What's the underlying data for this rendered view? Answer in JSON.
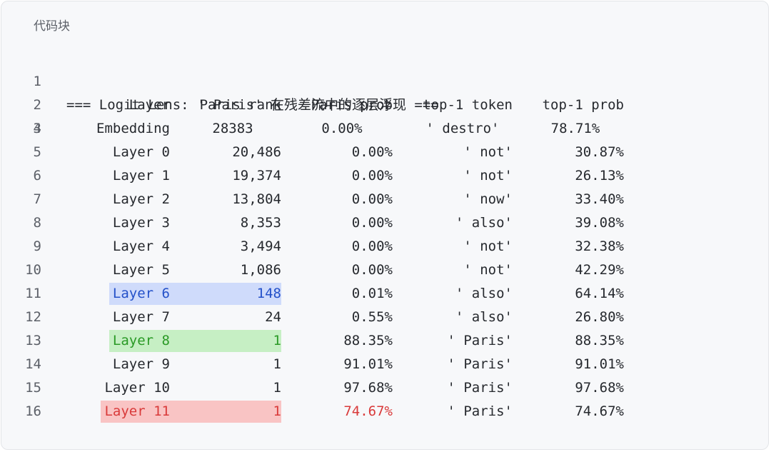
{
  "block_label": "代码块",
  "title_line": "=== Logit Lens: ' Paris' 在残差流中的逐层浮现 ===",
  "line_numbers": [
    "1",
    "2",
    "3",
    "4",
    "5",
    "6",
    "7",
    "8",
    "9",
    "10",
    "11",
    "12",
    "13",
    "14",
    "15",
    "16"
  ],
  "header": {
    "layer": "Layer",
    "rank": "Paris rank",
    "prob": "Paris prob",
    "token": "top-1 token",
    "tprob": "top-1 prob"
  },
  "rows": [
    {
      "layer": "Embedding",
      "rank": "28383",
      "prob": "0.00%",
      "token": "' destro'",
      "tprob": "78.71%"
    },
    {
      "layer": "Layer 0",
      "rank": "20,486",
      "prob": "0.00%",
      "token": "' not'",
      "tprob": "30.87%"
    },
    {
      "layer": "Layer 1",
      "rank": "19,374",
      "prob": "0.00%",
      "token": "' not'",
      "tprob": "26.13%"
    },
    {
      "layer": "Layer 2",
      "rank": "13,804",
      "prob": "0.00%",
      "token": "' now'",
      "tprob": "33.40%"
    },
    {
      "layer": "Layer 3",
      "rank": "8,353",
      "prob": "0.00%",
      "token": "' also'",
      "tprob": "39.08%"
    },
    {
      "layer": "Layer 4",
      "rank": "3,494",
      "prob": "0.00%",
      "token": "' not'",
      "tprob": "32.38%"
    },
    {
      "layer": "Layer 5",
      "rank": "1,086",
      "prob": "0.00%",
      "token": "' not'",
      "tprob": "42.29%"
    },
    {
      "layer": "Layer 6",
      "rank": "148",
      "prob": "0.01%",
      "token": "' also'",
      "tprob": "64.14%"
    },
    {
      "layer": "Layer 7",
      "rank": "24",
      "prob": "0.55%",
      "token": "' also'",
      "tprob": "26.80%"
    },
    {
      "layer": "Layer 8",
      "rank": "1",
      "prob": "88.35%",
      "token": "' Paris'",
      "tprob": "88.35%"
    },
    {
      "layer": "Layer 9",
      "rank": "1",
      "prob": "91.01%",
      "token": "' Paris'",
      "tprob": "91.01%"
    },
    {
      "layer": "Layer 10",
      "rank": "1",
      "prob": "97.68%",
      "token": "' Paris'",
      "tprob": "97.68%"
    },
    {
      "layer": "Layer 11",
      "rank": "1",
      "prob": "74.67%",
      "token": "' Paris'",
      "tprob": "74.67%"
    }
  ],
  "colors": {
    "blue_bg": "#cfdbfb",
    "blue_text": "#2451c9",
    "green_bg": "#c6efc4",
    "green_text": "#2a9a26",
    "red_bg": "#f9c4c4",
    "red_text": "#d93a3a"
  }
}
